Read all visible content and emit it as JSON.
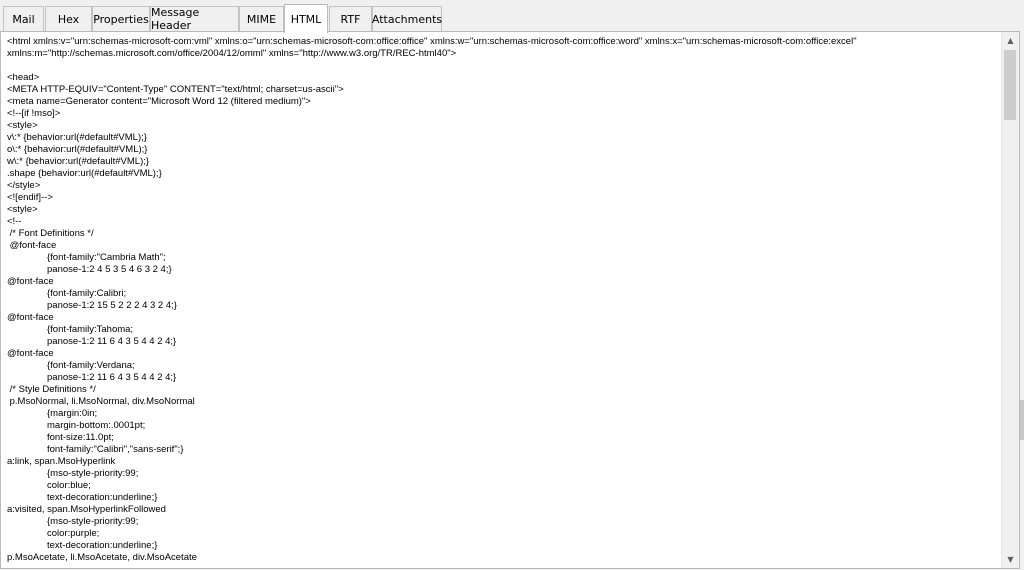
{
  "tabs": [
    {
      "label": "Mail",
      "active": false
    },
    {
      "label": "Hex",
      "active": false
    },
    {
      "label": "Properties",
      "active": false
    },
    {
      "label": "Message Header",
      "active": false
    },
    {
      "label": "MIME",
      "active": false
    },
    {
      "label": "HTML",
      "active": true
    },
    {
      "label": "RTF",
      "active": false
    },
    {
      "label": "Attachments",
      "active": false
    }
  ],
  "html_source": {
    "lines": [
      "<html xmlns:v=\"urn:schemas-microsoft-com:vml\" xmlns:o=\"urn:schemas-microsoft-com:office:office\" xmlns:w=\"urn:schemas-microsoft-com:office:word\" xmlns:x=\"urn:schemas-microsoft-com:office:excel\"",
      "xmlns:m=\"http://schemas.microsoft.com/office/2004/12/omml\" xmlns=\"http://www.w3.org/TR/REC-html40\">",
      "",
      "<head>",
      "<META HTTP-EQUIV=\"Content-Type\" CONTENT=\"text/html; charset=us-ascii\">",
      "<meta name=Generator content=\"Microsoft Word 12 (filtered medium)\">",
      "<!--[if !mso]>",
      "<style>",
      "v\\:* {behavior:url(#default#VML);}",
      "o\\:* {behavior:url(#default#VML);}",
      "w\\:* {behavior:url(#default#VML);}",
      ".shape {behavior:url(#default#VML);}",
      "</style>",
      "<![endif]-->",
      "<style>",
      "<!--",
      " /* Font Definitions */",
      " @font-face",
      "\t{font-family:\"Cambria Math\";",
      "\tpanose-1:2 4 5 3 5 4 6 3 2 4;}",
      "@font-face",
      "\t{font-family:Calibri;",
      "\tpanose-1:2 15 5 2 2 2 4 3 2 4;}",
      "@font-face",
      "\t{font-family:Tahoma;",
      "\tpanose-1:2 11 6 4 3 5 4 4 2 4;}",
      "@font-face",
      "\t{font-family:Verdana;",
      "\tpanose-1:2 11 6 4 3 5 4 4 2 4;}",
      " /* Style Definitions */",
      " p.MsoNormal, li.MsoNormal, div.MsoNormal",
      "\t{margin:0in;",
      "\tmargin-bottom:.0001pt;",
      "\tfont-size:11.0pt;",
      "\tfont-family:\"Calibri\",\"sans-serif\";}",
      "a:link, span.MsoHyperlink",
      "\t{mso-style-priority:99;",
      "\tcolor:blue;",
      "\ttext-decoration:underline;}",
      "a:visited, span.MsoHyperlinkFollowed",
      "\t{mso-style-priority:99;",
      "\tcolor:purple;",
      "\ttext-decoration:underline;}",
      "p.MsoAcetate, li.MsoAcetate, div.MsoAcetate"
    ]
  }
}
